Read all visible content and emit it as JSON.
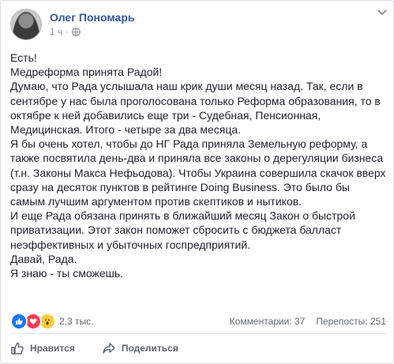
{
  "post": {
    "author": "Олег Пономарь",
    "time": "1 ч",
    "separator": "·",
    "text": "Есть!\nМедреформа принята Радой!\nДумаю, что Рада услышала наш крик души месяц назад. Так, если в сентябре у нас была проголосована только Реформа образования, то в октябре к ней добавились еще три - Судебная, Пенсионная, Медицинская. Итого - четыре за два месяца.\nЯ бы очень хотел, чтобы до НГ Рада приняла Земельную реформу, а также посвятила день-два и приняла все законы о дерегуляции бизнеса (т.н. Законы Макса Нефьодова). Чтобы Украина совершила скачок вверх сразу на десяток пунктов в рейтинге Doing Business. Это было бы самым лучшим аргументом против скептиков и нытиков.\nИ еще Рада обязана принять в ближайший месяц Закон о быстрой приватизации. Этот закон поможет сбросить с бюджета балласт неэффективных и убыточных госпредприятий.\nДавай, Рада.\nЯ знаю - ты сможешь."
  },
  "stats": {
    "reactions_count": "2,3 тыс.",
    "comments": "Комментарии: 37",
    "shares": "Перепосты: 251"
  },
  "actions": {
    "like": "Нравится",
    "share": "Поделиться"
  },
  "colors": {
    "author": "#365899",
    "like_blue": "#1877f2",
    "love_red": "#f33e58",
    "wow_yellow": "#fbcd40"
  },
  "icons": [
    "avatar",
    "globe-icon",
    "chevron-down-icon",
    "like-reaction-icon",
    "love-reaction-icon",
    "wow-reaction-icon",
    "thumbs-up-icon",
    "share-arrow-icon"
  ]
}
